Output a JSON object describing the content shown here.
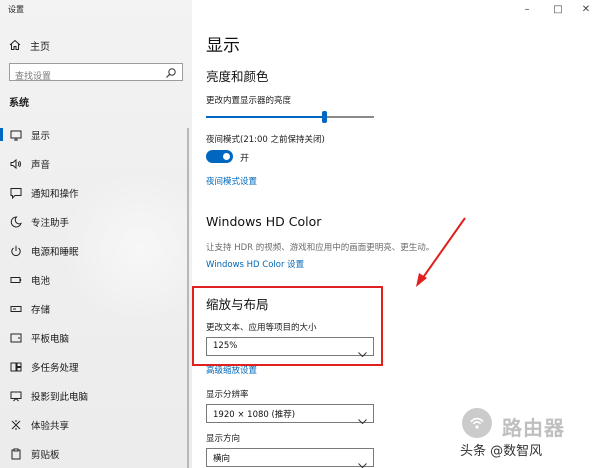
{
  "window": {
    "title": "设置",
    "controls": [
      "–",
      "□",
      "✕"
    ]
  },
  "sidebar": {
    "home_label": "主页",
    "search_placeholder": "查找设置",
    "section_label": "系统",
    "items": [
      {
        "label": "显示",
        "icon": "monitor-icon",
        "active": true
      },
      {
        "label": "声音",
        "icon": "speaker-icon"
      },
      {
        "label": "通知和操作",
        "icon": "message-icon"
      },
      {
        "label": "专注助手",
        "icon": "moon-icon"
      },
      {
        "label": "电源和睡眠",
        "icon": "power-icon"
      },
      {
        "label": "电池",
        "icon": "battery-icon"
      },
      {
        "label": "存储",
        "icon": "drive-icon"
      },
      {
        "label": "平板电脑",
        "icon": "tablet-icon"
      },
      {
        "label": "多任务处理",
        "icon": "multitask-icon"
      },
      {
        "label": "投影到此电脑",
        "icon": "projector-icon"
      },
      {
        "label": "体验共享",
        "icon": "share-icon"
      },
      {
        "label": "剪贴板",
        "icon": "clipboard-icon"
      }
    ]
  },
  "main": {
    "page_title": "显示",
    "brightness": {
      "heading": "亮度和颜色",
      "slider_label": "更改内置显示器的亮度",
      "slider_value": 0.7,
      "night_mode_label": "夜间模式(21:00 之前保持关闭)",
      "night_mode_state": "开",
      "night_mode_on": true,
      "night_mode_link": "夜间模式设置"
    },
    "hd_color": {
      "heading": "Windows HD Color",
      "description": "让支持 HDR 的视频、游戏和应用中的画面更明亮、更生动。",
      "link": "Windows HD Color 设置"
    },
    "scale_layout": {
      "heading": "缩放与布局",
      "scale_label": "更改文本、应用等项目的大小",
      "scale_value": "125%",
      "advanced_link": "高级缩放设置",
      "resolution_label": "显示分辨率",
      "resolution_value": "1920 × 1080 (推荐)",
      "orientation_label": "显示方向",
      "orientation_value": "横向"
    }
  },
  "watermark": {
    "brand": "路由器",
    "credit": "头条 @数智风"
  },
  "colors": {
    "accent": "#0067c0",
    "link": "#0067b8",
    "highlight_box": "#e0201e",
    "annotation_arrow": "#e0201e"
  }
}
